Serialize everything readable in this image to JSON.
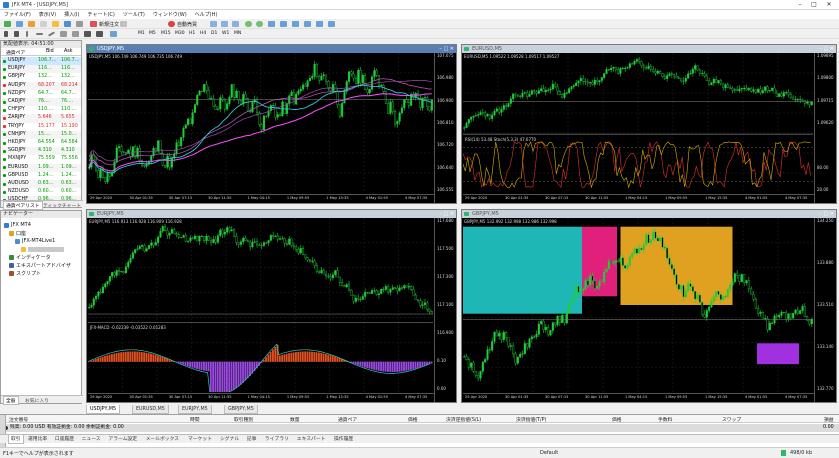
{
  "app": {
    "title": "JFX MT4 - [USDJPY,M5]"
  },
  "menu": [
    "ファイル(F)",
    "表示(V)",
    "挿入(I)",
    "チャート(C)",
    "ツール(T)",
    "ウィンドウ(W)",
    "ヘルプ(H)"
  ],
  "toolbar": {
    "new_order": "新規注文",
    "auto_trade": "自動売買",
    "timeframes": [
      "M1",
      "M5",
      "M15",
      "M30",
      "H1",
      "H4",
      "D1",
      "W1",
      "MN"
    ]
  },
  "market_watch": {
    "header": "気配値表示: 04:51:00",
    "columns": [
      "通貨ペア",
      "Bid",
      "Ask"
    ],
    "rows": [
      {
        "sym": "USDJPY",
        "bid": "106.7...",
        "ask": "106.7...",
        "color": "#00a000"
      },
      {
        "sym": "EURJPY",
        "bid": "116...",
        "ask": "116...",
        "color": "#00a000"
      },
      {
        "sym": "GBPJPY",
        "bid": "132...",
        "ask": "132...",
        "color": "#00a000"
      },
      {
        "sym": "AUDJPY",
        "bid": "68.207",
        "ask": "68.214",
        "color": "#e03030"
      },
      {
        "sym": "NZDJPY",
        "bid": "64.7...",
        "ask": "64.7...",
        "color": "#00a000"
      },
      {
        "sym": "CADJPY",
        "bid": "76....",
        "ask": "76....",
        "color": "#00a000"
      },
      {
        "sym": "CHFJPY",
        "bid": "110....",
        "ask": "110....",
        "color": "#00a000"
      },
      {
        "sym": "ZARJPY",
        "bid": "5.646",
        "ask": "5.655",
        "color": "#e03030"
      },
      {
        "sym": "TRYJPY",
        "bid": "15.177",
        "ask": "15.190",
        "color": "#e03030"
      },
      {
        "sym": "CNHJPY",
        "bid": "15....",
        "ask": "15.0...",
        "color": "#00a000"
      },
      {
        "sym": "HKDJPY",
        "bid": "64.554",
        "ask": "64.584",
        "color": "#00a000"
      },
      {
        "sym": "SGDJPY",
        "bid": "4.310",
        "ask": "4.310",
        "color": "#00a000"
      },
      {
        "sym": "MXNJPY",
        "bid": "75.559",
        "ask": "75.556",
        "color": "#00a000"
      },
      {
        "sym": "EURUSD",
        "bid": "1.09...",
        "ask": "1.09...",
        "color": "#00a000"
      },
      {
        "sym": "GBPUSD",
        "bid": "1.24...",
        "ask": "1.24...",
        "color": "#00a000"
      },
      {
        "sym": "AUDUSD",
        "bid": "0.63...",
        "ask": "0.63...",
        "color": "#00a000"
      },
      {
        "sym": "NZDUSD",
        "bid": "0.60...",
        "ask": "0.60...",
        "color": "#00a000"
      },
      {
        "sym": "USDCHF",
        "bid": "0.96...",
        "ask": "0.96...",
        "color": "#00a000"
      }
    ],
    "tabs": [
      "通貨ペアリスト",
      "ティックチャート"
    ]
  },
  "navigator": {
    "header": "ナビゲーター",
    "items": [
      "JFX MT4",
      "口座",
      "JFX-MT4Live1",
      "",
      "インディケータ",
      "エキスパートアドバイザ",
      "スクリプト"
    ],
    "tabs": [
      "全般",
      "お気に入り"
    ]
  },
  "charts": [
    {
      "title": "USDJPY,M5",
      "info": "USDJPY,M5 106.749 106.749 106.735 106.749",
      "sub": "",
      "active": true,
      "prices": [
        "107.075",
        "106.980",
        "106.900",
        "106.810",
        "106.720",
        "106.640",
        "106.555"
      ],
      "times": [
        "29 Apr 2020",
        "30 Apr 01:35",
        "30 Apr 07:15",
        "30 Apr 11:55",
        "1 May 04:15",
        "1 May 09:55",
        "1 May 15:35",
        "4 May 01:55",
        "4 May 07:35"
      ]
    },
    {
      "title": "EURUSD,M5",
      "info": "EURUSD,M5 1.09522 1.09528 1.09517 1.09527",
      "sub": "RSI(14) 53.48 Stoch(5,3,3) 47.6770",
      "active": false,
      "prices": [
        "1.09895",
        "1.09800",
        "1.09715",
        "1.09620",
        "",
        "80.00",
        "20.00"
      ],
      "times": [
        "29 Apr 2020",
        "30 Apr 01:35",
        "30 Apr 07:15",
        "30 Apr 11:55",
        "1 May 04:15",
        "1 May 09:55",
        "1 May 15:35",
        "4 May 01:55",
        "4 May 07:35"
      ]
    },
    {
      "title": "EURJPY,M5",
      "info": "EURJPY,M5 116.913 116.928 116.909 116.928",
      "sub": "JFX-MACD -0.02239 -0.03522 0.01283",
      "active": false,
      "prices": [
        "117.680",
        "117.500",
        "117.300",
        "117.100",
        "116.900",
        "0.10",
        "0.00"
      ],
      "times": [
        "29 Apr 2020",
        "30 Apr 01:35",
        "30 Apr 07:15",
        "30 Apr 11:55",
        "1 May 04:15",
        "1 May 09:55",
        "1 May 15:35",
        "4 May 01:55",
        "4 May 07:35"
      ]
    },
    {
      "title": "GBPJPY,M5",
      "info": "GBPJPY,M5 132.992 132.998 132.986 132.998",
      "sub": "",
      "active": false,
      "prices": [
        "134.250",
        "133.880",
        "133.510",
        "133.140",
        "132.770"
      ],
      "times": [
        "29 Apr 2020",
        "30 Apr 01:35",
        "30 Apr 07:15",
        "30 Apr 11:55",
        "1 May 04:15",
        "1 May 09:55",
        "1 May 15:35",
        "4 May 01:55",
        "4 May 07:35"
      ]
    }
  ],
  "chart_tabs": [
    "USDJPY,M5",
    "EURUSD,M5",
    "EURJPY,M5",
    "GBPJPY,M5"
  ],
  "terminal": {
    "columns": [
      "注文番号",
      "時間",
      "取引種別",
      "数量",
      "通貨ペア",
      "価格",
      "決済逆指値(S/L)",
      "決済指値(T/P)",
      "価格",
      "手数料",
      "スワップ",
      "損益"
    ],
    "balance": "残高: 0.00 USD  有効証拠金: 0.00  余剰証拠金: 0.00",
    "balance_value": "0.00",
    "tabs": [
      "取引",
      "運用比率",
      "口座履歴",
      "ニュース",
      "アラーム設定",
      "メールボックス",
      "マーケット",
      "シグナル",
      "記事",
      "ライブラリ",
      "エキスパート",
      "操作履歴"
    ]
  },
  "status": {
    "help": "F1キーでヘルプが表示されます",
    "profile": "Default",
    "conn": "498/0 kb"
  }
}
